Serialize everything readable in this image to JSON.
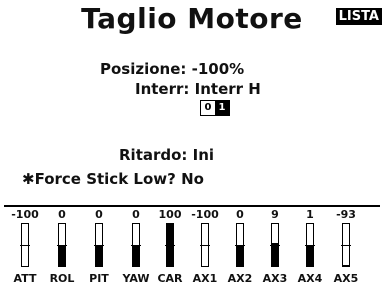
{
  "header": {
    "title": "Taglio Motore",
    "badge": "LISTA"
  },
  "settings": {
    "posizione_label": "Posizione:",
    "posizione_value": "-100%",
    "interr_label": "Interr:",
    "interr_value": "Interr H",
    "switch_positions": [
      "0",
      "1"
    ],
    "switch_active_index": 1,
    "ritardo_label": "Ritardo:",
    "ritardo_value": "Ini",
    "force_label": "✱Force Stick Low?",
    "force_value": "No"
  },
  "channels": [
    {
      "label": "ATT",
      "value": "-100",
      "level": -100
    },
    {
      "label": "ROL",
      "value": "0",
      "level": 0
    },
    {
      "label": "PIT",
      "value": "0",
      "level": 0
    },
    {
      "label": "YAW",
      "value": "0",
      "level": 0
    },
    {
      "label": "CAR",
      "value": "100",
      "level": 100
    },
    {
      "label": "AX1",
      "value": "-100",
      "level": -100
    },
    {
      "label": "AX2",
      "value": "0",
      "level": 0
    },
    {
      "label": "AX3",
      "value": "9",
      "level": 9
    },
    {
      "label": "AX4",
      "value": "1",
      "level": 1
    },
    {
      "label": "AX5",
      "value": "-93",
      "level": -93
    }
  ]
}
